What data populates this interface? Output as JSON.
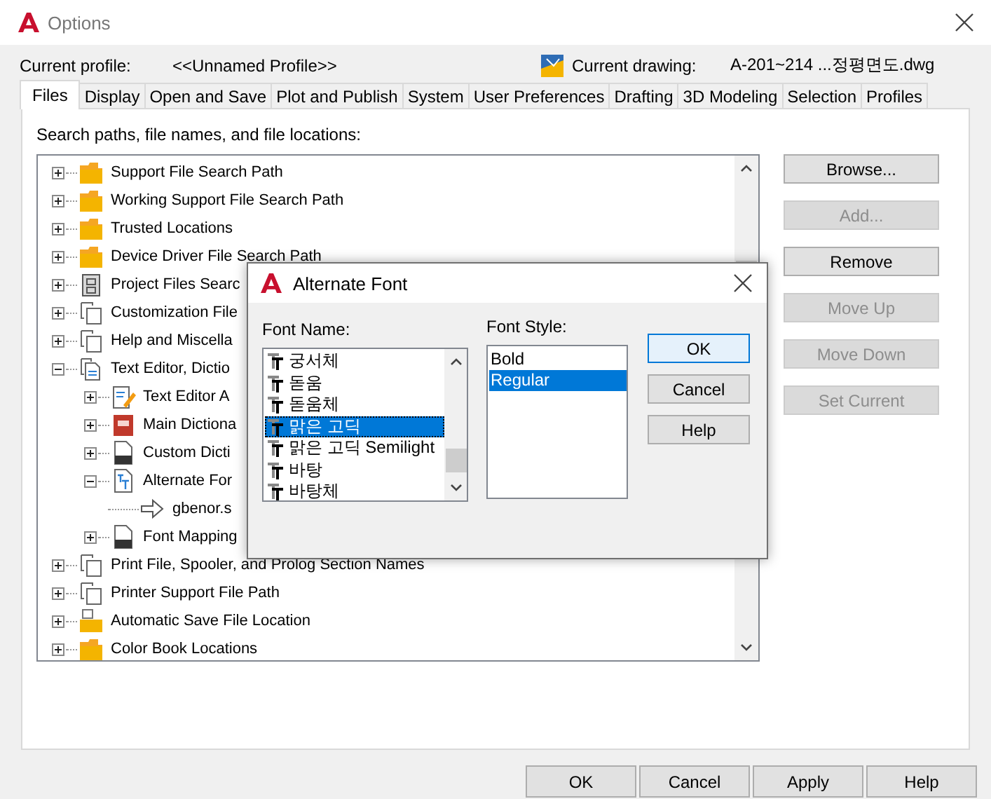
{
  "window": {
    "title": "Options"
  },
  "profile": {
    "label": "Current profile:",
    "value": "<<Unnamed Profile>>"
  },
  "drawing": {
    "label": "Current drawing:",
    "value": "A-201~214 ...정평면도.dwg"
  },
  "tabs": [
    {
      "label": "Files",
      "selected": true
    },
    {
      "label": "Display",
      "selected": false
    },
    {
      "label": "Open and Save",
      "selected": false
    },
    {
      "label": "Plot and Publish",
      "selected": false
    },
    {
      "label": "System",
      "selected": false
    },
    {
      "label": "User Preferences",
      "selected": false
    },
    {
      "label": "Drafting",
      "selected": false
    },
    {
      "label": "3D Modeling",
      "selected": false
    },
    {
      "label": "Selection",
      "selected": false
    },
    {
      "label": "Profiles",
      "selected": false
    }
  ],
  "tree": {
    "label": "Search paths, file names, and file locations:",
    "items": [
      {
        "label": "Support File Search Path",
        "kind": "folder",
        "expanded": false
      },
      {
        "label": "Working Support File Search Path",
        "kind": "folder",
        "expanded": false
      },
      {
        "label": "Trusted Locations",
        "kind": "folder",
        "expanded": false
      },
      {
        "label": "Device Driver File Search Path",
        "kind": "folder",
        "expanded": false
      },
      {
        "label": "Project Files Searc",
        "kind": "project",
        "expanded": false
      },
      {
        "label": "Customization File",
        "kind": "files",
        "expanded": false
      },
      {
        "label": "Help and Miscella",
        "kind": "files",
        "expanded": false
      },
      {
        "label": "Text Editor, Dictio",
        "kind": "document",
        "expanded": true,
        "children": [
          {
            "label": "Text Editor A",
            "kind": "editor",
            "expanded": false
          },
          {
            "label": "Main Dictiona",
            "kind": "dictionary",
            "expanded": false
          },
          {
            "label": "Custom Dicti",
            "kind": "cui",
            "expanded": false
          },
          {
            "label": "Alternate For",
            "kind": "font",
            "expanded": true,
            "children": [
              {
                "label": "gbenor.s",
                "kind": "link"
              }
            ]
          },
          {
            "label": "Font Mapping",
            "kind": "psf",
            "expanded": false
          }
        ]
      },
      {
        "label": "Print File, Spooler, and Prolog Section Names",
        "kind": "files",
        "expanded": false
      },
      {
        "label": "Printer Support File Path",
        "kind": "files",
        "expanded": false
      },
      {
        "label": "Automatic Save File Location",
        "kind": "save-folder",
        "expanded": false
      },
      {
        "label": "Color Book Locations",
        "kind": "folder",
        "expanded": false
      }
    ]
  },
  "side_buttons": [
    {
      "label": "Browse...",
      "disabled": false
    },
    {
      "label": "Add...",
      "disabled": true
    },
    {
      "label": "Remove",
      "disabled": false
    },
    {
      "label": "Move Up",
      "disabled": true
    },
    {
      "label": "Move Down",
      "disabled": true
    },
    {
      "label": "Set Current",
      "disabled": true
    }
  ],
  "buttons": [
    {
      "label": "OK"
    },
    {
      "label": "Cancel"
    },
    {
      "label": "Apply"
    },
    {
      "label": "Help"
    }
  ],
  "dialog": {
    "title": "Alternate Font",
    "font_name": {
      "label": "Font Name:",
      "items": [
        {
          "label": "궁서체",
          "selected": false
        },
        {
          "label": "돋움",
          "selected": false
        },
        {
          "label": "돋움체",
          "selected": false
        },
        {
          "label": "맑은 고딕",
          "selected": true
        },
        {
          "label": "맑은 고딕 Semilight",
          "selected": false
        },
        {
          "label": "바탕",
          "selected": false
        },
        {
          "label": "바탕체",
          "selected": false
        }
      ]
    },
    "font_style": {
      "label": "Font Style:",
      "items": [
        {
          "label": "Bold",
          "selected": false
        },
        {
          "label": "Regular",
          "selected": true
        }
      ]
    },
    "buttons": [
      {
        "label": "OK",
        "default": true
      },
      {
        "label": "Cancel",
        "default": false
      },
      {
        "label": "Help",
        "default": false
      }
    ]
  }
}
